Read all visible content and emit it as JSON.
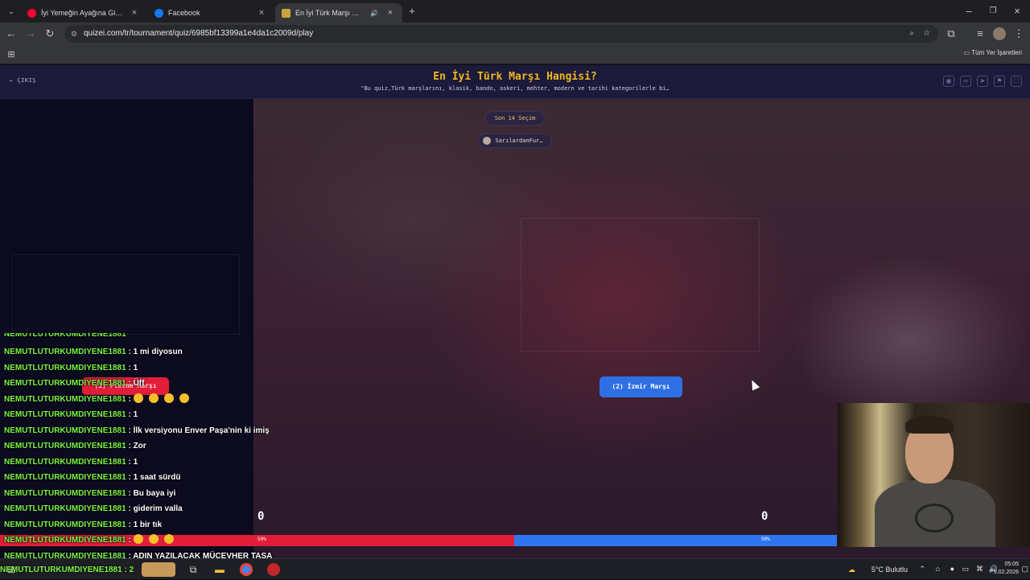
{
  "browser": {
    "tabs": [
      {
        "title": "İyi Yemeğin Ayağına Gidilir #9 |",
        "favicon": "youtube-icon",
        "active": false
      },
      {
        "title": "Facebook",
        "favicon": "facebook-icon",
        "active": false
      },
      {
        "title": "En İyi Türk Marşı Hangisi?",
        "favicon": "quizei-icon",
        "active": true
      }
    ],
    "url": "quizei.com/tr/tournament/quiz/6985bf13399a1e4da1c2009d/play",
    "bookmarks_label": "Tüm Yer İşaretleri"
  },
  "quiz": {
    "exit_label": "ÇIKIŞ",
    "title": "En İyi Türk Marşı Hangisi?",
    "subtitle": "\"Bu quiz,Türk marşlarını, klasik, bando, askeri, mehter, modern ve tarihi kategorilerle bi…",
    "round_label": "Son 14 Seçim",
    "host_name": "SarılardanFur…",
    "choice1_label": "(1) Plevne Marşı",
    "choice2_label": "(2) İzmir Marşı",
    "score_left": "0",
    "score_right": "0",
    "vote_left_pct": "50%",
    "vote_right_pct": "50%",
    "vote_left_fraction": 0.5,
    "colors": {
      "accent_gold": "#f2b71e",
      "left_red": "#e11d39",
      "right_blue": "#2f75f0"
    }
  },
  "chat": {
    "username": "NEMUTLUTURKUMDIYENE1881",
    "messages": [
      {
        "text": "1 mi diyosun"
      },
      {
        "text": "1"
      },
      {
        "text": "Üff"
      },
      {
        "text": "",
        "emoji_count": 4
      },
      {
        "text": "1"
      },
      {
        "text": "İlk versiyonu Enver Paşa'nin ki imiş"
      },
      {
        "text": "Zor"
      },
      {
        "text": "1"
      },
      {
        "text": "1 saat sürdü"
      },
      {
        "text": "Bu baya iyi"
      },
      {
        "text": "giderim valla"
      },
      {
        "text": "1 bir tık"
      },
      {
        "text": "",
        "emoji_count": 3
      },
      {
        "text": "ADIN YAZILACAK MÜCEVHER TAŞA"
      }
    ],
    "taskbar_overlay": "NEMUTLUTURKUMDIYENE1881 : 2"
  },
  "taskbar": {
    "weather": "5°C  Bulutlu",
    "time": "05:05",
    "date": "9.02.2026"
  }
}
